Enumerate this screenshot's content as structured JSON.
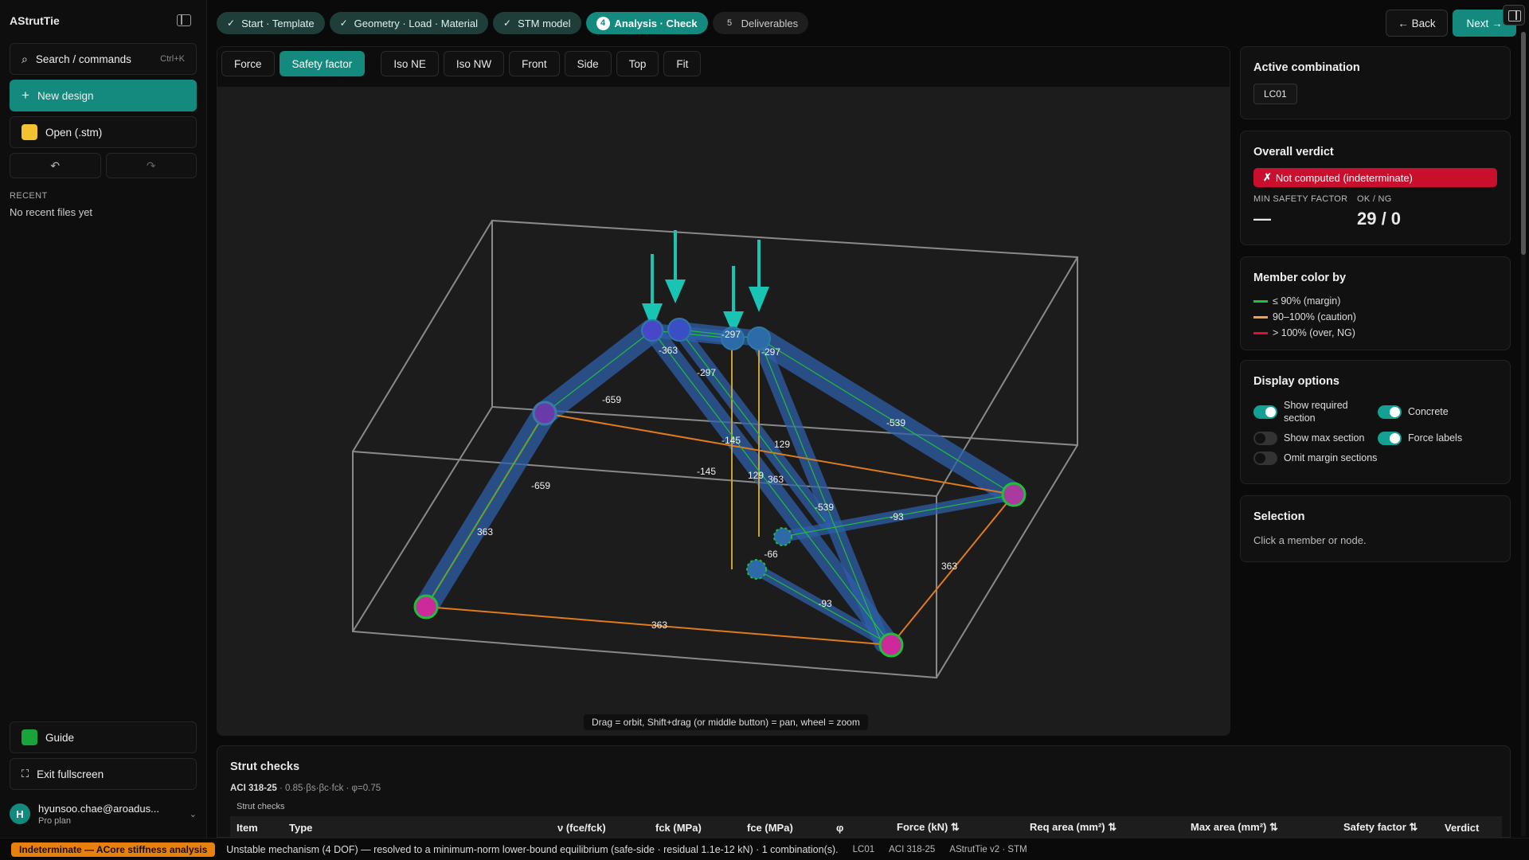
{
  "app": {
    "title": "AStrutTie"
  },
  "sidebar": {
    "search_label": "Search / commands",
    "search_shortcut": "Ctrl+K",
    "new_label": "New design",
    "open_label": "Open (.stm)",
    "recent_heading": "RECENT",
    "recent_empty": "No recent files yet",
    "guide_label": "Guide",
    "exit_label": "Exit fullscreen",
    "user_email": "hyunsoo.chae@aroadus...",
    "user_plan": "Pro plan",
    "user_initial": "H"
  },
  "stepper": {
    "steps": [
      {
        "label": "Start · Template",
        "state": "done"
      },
      {
        "label": "Geometry · Load · Material",
        "state": "done"
      },
      {
        "label": "STM model",
        "state": "done"
      },
      {
        "label": "Analysis · Check",
        "state": "active",
        "num": "4"
      },
      {
        "label": "Deliverables",
        "state": "pending",
        "num": "5"
      }
    ],
    "back_label": "← Back",
    "next_label": "Next →"
  },
  "toolbar": {
    "force": "Force",
    "safety_factor": "Safety factor",
    "iso_ne": "Iso NE",
    "iso_nw": "Iso NW",
    "front": "Front",
    "side": "Side",
    "top": "Top",
    "fit": "Fit"
  },
  "viewport": {
    "hint": "Drag = orbit, Shift+drag (or middle button) = pan, wheel = zoom",
    "member_labels": [
      "-297",
      "-297",
      "-363",
      "-297",
      "-659",
      "-539",
      "-145",
      "129",
      "-145",
      "129",
      "363",
      "-659",
      "-539",
      "-93",
      "363",
      "-66",
      "363",
      "-93",
      "363"
    ]
  },
  "panel": {
    "active_combo_title": "Active combination",
    "active_combo_value": "LC01",
    "verdict_title": "Overall verdict",
    "verdict_text": "Not computed (indeterminate)",
    "verdict_mark": "✗",
    "min_sf_label": "MIN SAFETY FACTOR",
    "ok_ng_label": "OK / NG",
    "min_sf_value": "—",
    "ok_ng_value": "29 / 0",
    "color_by_title": "Member color by",
    "legend": [
      {
        "label": "≤ 90% (margin)",
        "color": "#1fbf3a"
      },
      {
        "label": "90–100% (caution)",
        "color": "#f0a050"
      },
      {
        "label": "> 100% (over, NG)",
        "color": "#e0102e"
      }
    ],
    "display_title": "Display options",
    "toggles": {
      "show_required": "Show required section",
      "concrete": "Concrete",
      "show_max": "Show max section",
      "force_labels": "Force labels",
      "omit_margin": "Omit margin sections"
    },
    "selection_title": "Selection",
    "selection_hint": "Click a member or node."
  },
  "checks": {
    "title": "Strut checks",
    "code": "ACI 318-25",
    "formula": "· 0.85·βs·βc·fck · φ=0.75",
    "caption": "Strut checks",
    "columns": [
      "Item",
      "Type",
      "ν (fce/fck)",
      "fck (MPa)",
      "fce (MPa)",
      "φ",
      "Force (kN) ⇅",
      "Req area (mm²) ⇅",
      "Max area (mm²) ⇅",
      "Safety factor ⇅",
      "Verdict"
    ]
  },
  "status": {
    "badge": "Indeterminate — ACore stiffness analysis",
    "message": "Unstable mechanism (4 DOF) — resolved to a minimum-norm lower-bound equilibrium (safe-side · residual 1.1e-12 kN) · 1 combination(s).",
    "combo": "LC01",
    "code": "ACI 318-25",
    "version": "AStrutTie v2 · STM"
  },
  "colors": {
    "accent": "#138a7d",
    "verdict_ng": "#c8102e",
    "status_badge": "#e8800d",
    "strut_blue": "#2d5fa8",
    "tie_orange": "#e07b1c",
    "load_arrow": "#19c4b4",
    "node_magenta": "#cc2a9a"
  }
}
